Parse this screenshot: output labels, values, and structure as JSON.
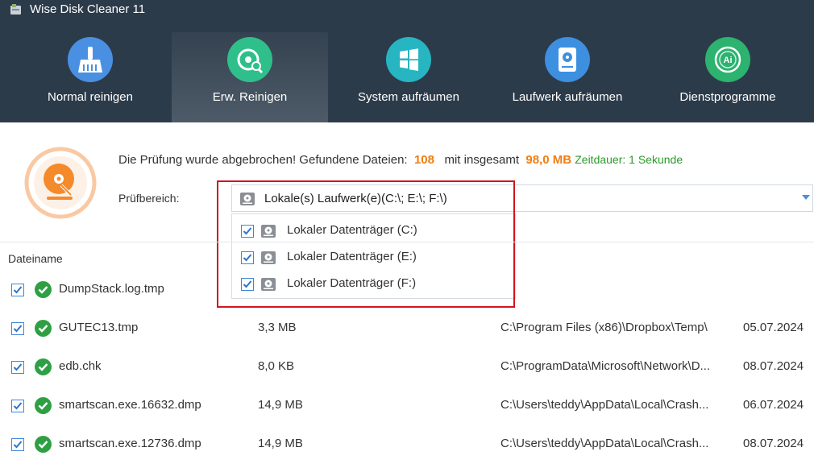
{
  "app": {
    "title": "Wise Disk Cleaner 11"
  },
  "tabs": [
    {
      "label": "Normal reinigen",
      "icon": "broom-icon",
      "color": "#4a90e2"
    },
    {
      "label": "Erw. Reinigen",
      "icon": "disk-search-icon",
      "color": "#2fbf8a"
    },
    {
      "label": "System aufräumen",
      "icon": "windows-icon",
      "color": "#27b5c2"
    },
    {
      "label": "Laufwerk aufräumen",
      "icon": "drive-icon",
      "color": "#3d8fe0"
    },
    {
      "label": "Dienstprogramme",
      "icon": "ai-icon",
      "color": "#2bb36f"
    }
  ],
  "active_tab": "Erw. Reinigen",
  "status": {
    "prefix": "Die Prüfung wurde abgebrochen! Gefundene Dateien:",
    "count": "108",
    "middle": "mit insgesamt",
    "size": "98,0 MB",
    "duration": "Zeitdauer: 1 Sekunde"
  },
  "scope": {
    "label": "Prüfbereich:",
    "value": "Lokale(s) Laufwerk(e)(C:\\; E:\\; F:\\)",
    "options": [
      {
        "label": "Lokaler Datenträger (C:)",
        "checked": true
      },
      {
        "label": "Lokaler Datenträger (E:)",
        "checked": true
      },
      {
        "label": "Lokaler Datenträger (F:)",
        "checked": true
      }
    ]
  },
  "table": {
    "header_name": "Dateiname",
    "rows": [
      {
        "name": "DumpStack.log.tmp",
        "size": "",
        "path": "",
        "date": ""
      },
      {
        "name": "GUTEC13.tmp",
        "size": "3,3 MB",
        "path": "C:\\Program Files (x86)\\Dropbox\\Temp\\",
        "date": "05.07.2024"
      },
      {
        "name": "edb.chk",
        "size": "8,0 KB",
        "path": "C:\\ProgramData\\Microsoft\\Network\\D...",
        "date": "08.07.2024"
      },
      {
        "name": "smartscan.exe.16632.dmp",
        "size": "14,9 MB",
        "path": "C:\\Users\\teddy\\AppData\\Local\\Crash...",
        "date": "06.07.2024"
      },
      {
        "name": "smartscan.exe.12736.dmp",
        "size": "14,9 MB",
        "path": "C:\\Users\\teddy\\AppData\\Local\\Crash...",
        "date": "08.07.2024"
      }
    ]
  }
}
